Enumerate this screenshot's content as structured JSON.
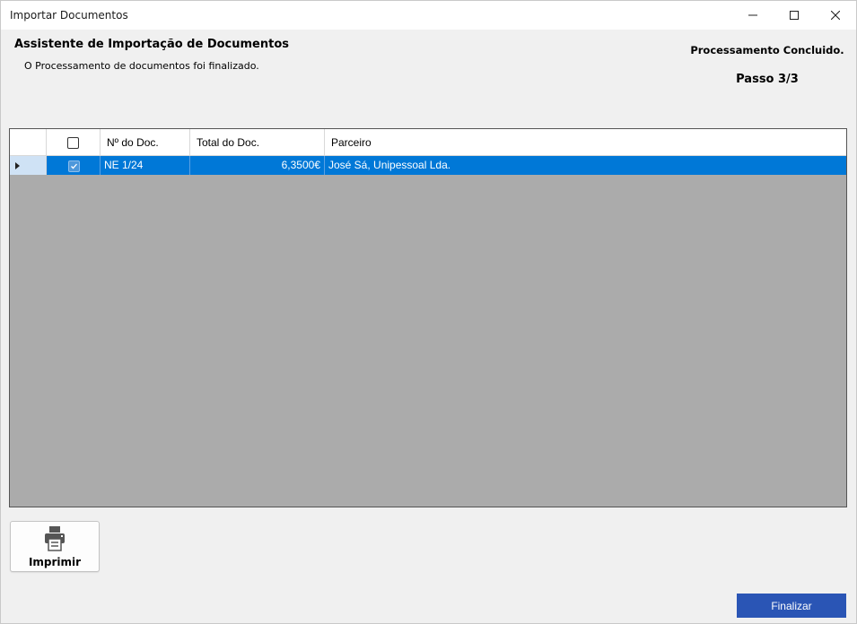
{
  "window": {
    "title": "Importar Documentos"
  },
  "header": {
    "title": "Assistente de Importação de Documentos",
    "subtitle": "O Processamento de documentos foi finalizado.",
    "status": "Processamento Concluido.",
    "step": "Passo 3/3"
  },
  "grid": {
    "columns": [
      "",
      "",
      "Nº do Doc.",
      "Total do Doc.",
      "Parceiro"
    ],
    "rows": [
      {
        "selected": true,
        "checked": true,
        "doc_number": "NE 1/24",
        "total": "6,3500€",
        "partner": "José Sá, Unipessoal Lda."
      }
    ]
  },
  "buttons": {
    "print": "Imprimir",
    "finish": "Finalizar"
  },
  "colors": {
    "selection": "#0078d7",
    "finish_button": "#2a55b5",
    "grid_background": "#ababab"
  }
}
